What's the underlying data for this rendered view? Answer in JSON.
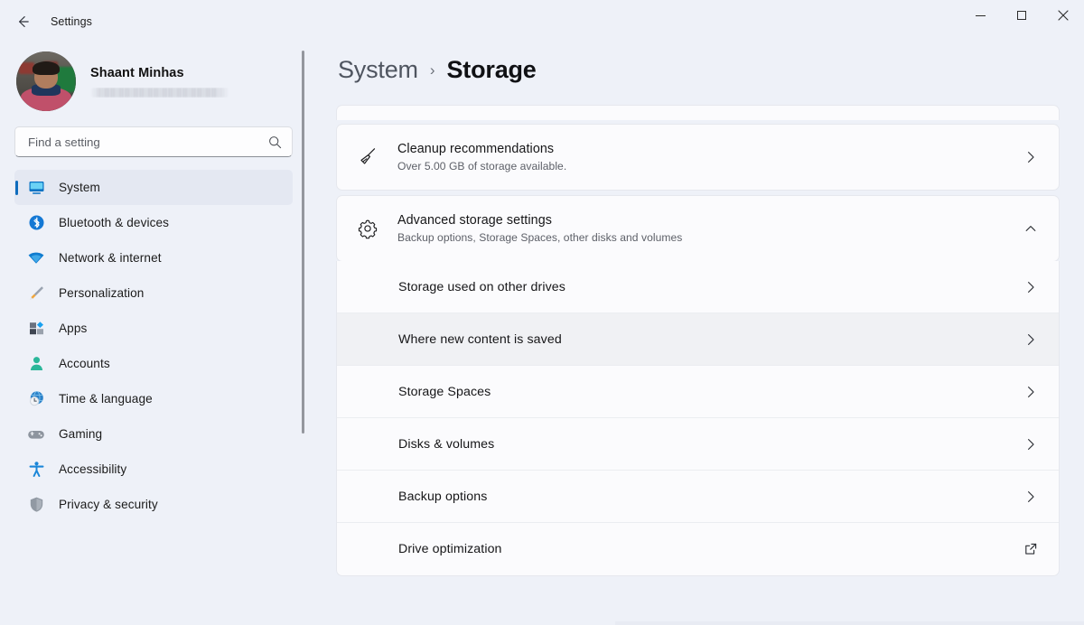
{
  "window": {
    "app_title": "Settings",
    "back_icon": "back-arrow-icon",
    "controls": {
      "minimize": "minimize-icon",
      "maximize": "maximize-icon",
      "close": "close-icon"
    }
  },
  "sidebar": {
    "account": {
      "name": "Shaant Minhas",
      "email_redacted": "",
      "avatar": "user-avatar"
    },
    "search": {
      "placeholder": "Find a setting",
      "value": "",
      "icon": "search-icon"
    },
    "items": [
      {
        "label": "System",
        "icon": "monitor-icon",
        "active": true
      },
      {
        "label": "Bluetooth & devices",
        "icon": "bluetooth-icon",
        "active": false
      },
      {
        "label": "Network & internet",
        "icon": "wifi-icon",
        "active": false
      },
      {
        "label": "Personalization",
        "icon": "paintbrush-icon",
        "active": false
      },
      {
        "label": "Apps",
        "icon": "apps-icon",
        "active": false
      },
      {
        "label": "Accounts",
        "icon": "person-icon",
        "active": false
      },
      {
        "label": "Time & language",
        "icon": "clock-globe-icon",
        "active": false
      },
      {
        "label": "Gaming",
        "icon": "gamepad-icon",
        "active": false
      },
      {
        "label": "Accessibility",
        "icon": "accessibility-icon",
        "active": false
      },
      {
        "label": "Privacy & security",
        "icon": "shield-icon",
        "active": false
      }
    ]
  },
  "breadcrumb": {
    "parent": "System",
    "separator": "›",
    "current": "Storage"
  },
  "main": {
    "cleanup": {
      "title": "Cleanup recommendations",
      "subtitle": "Over 5.00 GB of storage available.",
      "icon": "broom-icon",
      "chevron": "chevron-right-icon"
    },
    "advanced": {
      "title": "Advanced storage settings",
      "subtitle": "Backup options, Storage Spaces, other disks and volumes",
      "icon": "gear-icon",
      "chevron": "chevron-up-icon",
      "expanded": true,
      "sub_items": [
        {
          "label": "Storage used on other drives",
          "trailing": "chevron-right-icon",
          "hovered": false
        },
        {
          "label": "Where new content is saved",
          "trailing": "chevron-right-icon",
          "hovered": true
        },
        {
          "label": "Storage Spaces",
          "trailing": "chevron-right-icon",
          "hovered": false
        },
        {
          "label": "Disks & volumes",
          "trailing": "chevron-right-icon",
          "hovered": false
        },
        {
          "label": "Backup options",
          "trailing": "chevron-right-icon",
          "hovered": false
        },
        {
          "label": "Drive optimization",
          "trailing": "external-link-icon",
          "hovered": false
        }
      ]
    }
  },
  "colors": {
    "accent": "#0f6cbd",
    "window_bg": "#eef1f8",
    "card_bg": "#fbfbfd",
    "card_border": "#e6e8ee",
    "hover_row": "#f0f1f4",
    "text_primary": "#161618",
    "text_secondary": "#5d6068"
  }
}
